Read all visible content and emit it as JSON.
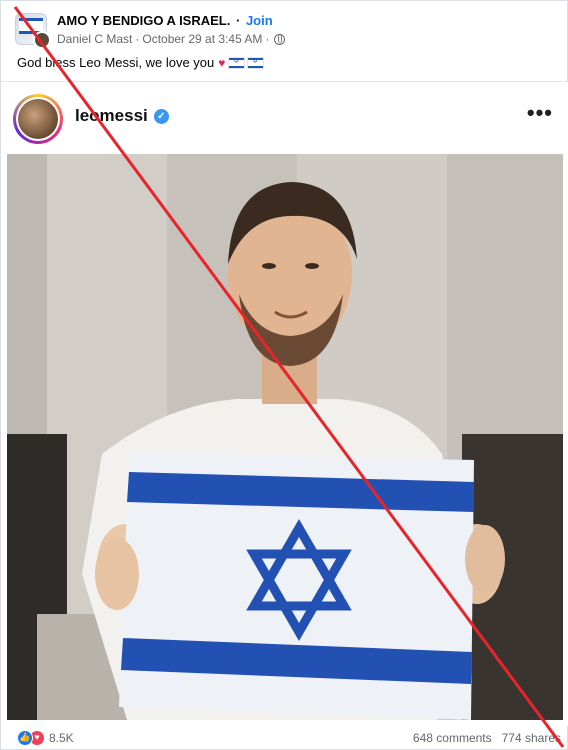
{
  "post": {
    "group_name": "AMO Y BENDIGO A ISRAEL.",
    "separator": "·",
    "join_label": "Join",
    "author": "Daniel C Mast",
    "timestamp": "October 29 at 3:45 AM",
    "meta_separator": "·",
    "audience_icon": "globe-icon",
    "text": "God bless Leo Messi, we love you",
    "text_emojis": [
      "heart-icon",
      "israel-flag-icon",
      "israel-flag-icon"
    ]
  },
  "instagram": {
    "username": "leomessi",
    "verified": true,
    "verified_icon": "verified-badge-icon",
    "more_icon": "ellipsis-icon"
  },
  "footer": {
    "reaction_icons": [
      "like-icon",
      "love-icon"
    ],
    "reaction_count": "8.5K",
    "comments": "648 comments",
    "shares": "774 shares"
  },
  "colors": {
    "link": "#1877f2",
    "strike": "#e8242b",
    "flag_blue": "#1d57b8"
  }
}
